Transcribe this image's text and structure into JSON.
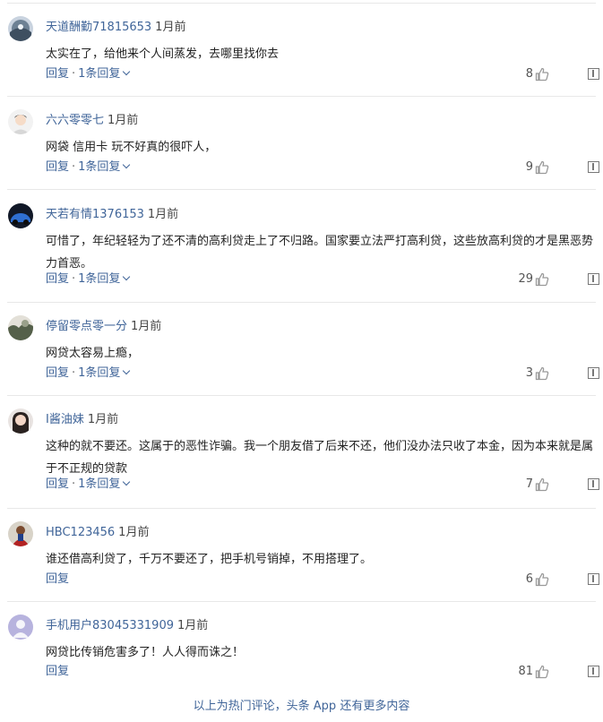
{
  "comments": [
    {
      "user": "天道酬勤71815653",
      "time": "1月前",
      "text": "太实在了，给他来个人间蒸发，去哪里找你去",
      "reply": "回复",
      "dot": "·",
      "replies": "1条回复",
      "likes": "8"
    },
    {
      "user": "六六零零七",
      "time": "1月前",
      "text": "网袋 信用卡 玩不好真的很吓人，",
      "reply": "回复",
      "dot": "·",
      "replies": "1条回复",
      "likes": "9"
    },
    {
      "user": "天若有情1376153",
      "time": "1月前",
      "text": "可惜了，年纪轻轻为了还不清的高利贷走上了不归路。国家要立法严打高利贷，这些放高利贷的才是黑恶势力首恶。",
      "reply": "回复",
      "dot": "·",
      "replies": "1条回复",
      "likes": "29"
    },
    {
      "user": "停留零点零一分",
      "time": "1月前",
      "text": "网贷太容易上瘾，",
      "reply": "回复",
      "dot": "·",
      "replies": "1条回复",
      "likes": "3"
    },
    {
      "user": "I酱油妹",
      "time": "1月前",
      "text": "这种的就不要还。这属于的恶性诈骗。我一个朋友借了后来不还，他们没办法只收了本金，因为本来就是属于不正规的贷款",
      "reply": "回复",
      "dot": "·",
      "replies": "1条回复",
      "likes": "7"
    },
    {
      "user": "HBC123456",
      "time": "1月前",
      "text": "谁还借高利贷了，千万不要还了，把手机号销掉，不用搭理了。",
      "reply": "回复",
      "likes": "6"
    },
    {
      "user": "手机用户83045331909",
      "time": "1月前",
      "text": "网贷比传销危害多了！人人得而诛之！",
      "reply": "回复",
      "likes": "81"
    }
  ],
  "footer": "以上为热门评论，头条 App 还有更多内容"
}
